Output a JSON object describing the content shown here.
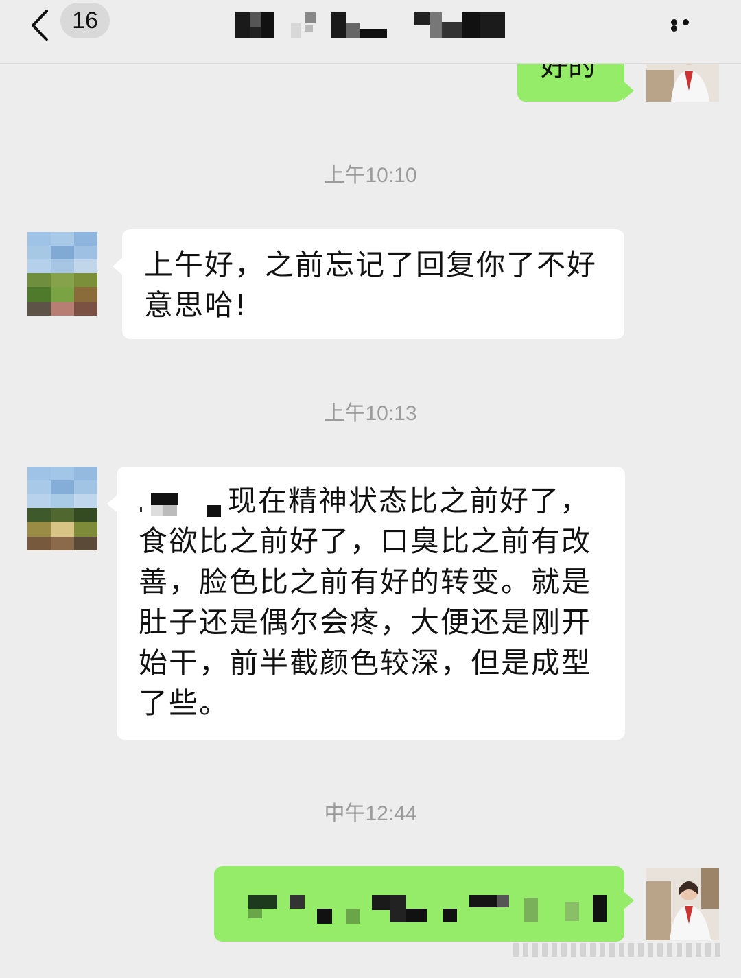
{
  "header": {
    "back_icon": "chevron-left-icon",
    "unread_count": "16",
    "title": "",
    "more_icon": "more-dots-icon"
  },
  "messages": [
    {
      "type": "out",
      "text": "好的"
    },
    {
      "type": "time",
      "text": "上午10:10"
    },
    {
      "type": "in",
      "text": "上午好，之前忘记了回复你了不好意思哈!"
    },
    {
      "type": "time",
      "text": "上午10:13"
    },
    {
      "type": "in",
      "text_after_redaction": "现在精神状态比之前好了，",
      "text_rest": "食欲比之前好了，口臭比之前有改善，脸色比之前有好的转变。就是肚子还是偶尔会疼，大便还是刚开始干，前半截颜色较深，但是成型了些。"
    },
    {
      "type": "time",
      "text": "中午12:44"
    },
    {
      "type": "out",
      "text": ""
    }
  ],
  "colors": {
    "background": "#ededed",
    "incoming_bubble": "#ffffff",
    "outgoing_bubble": "#95ec69",
    "timestamp": "#9b9b9b"
  }
}
